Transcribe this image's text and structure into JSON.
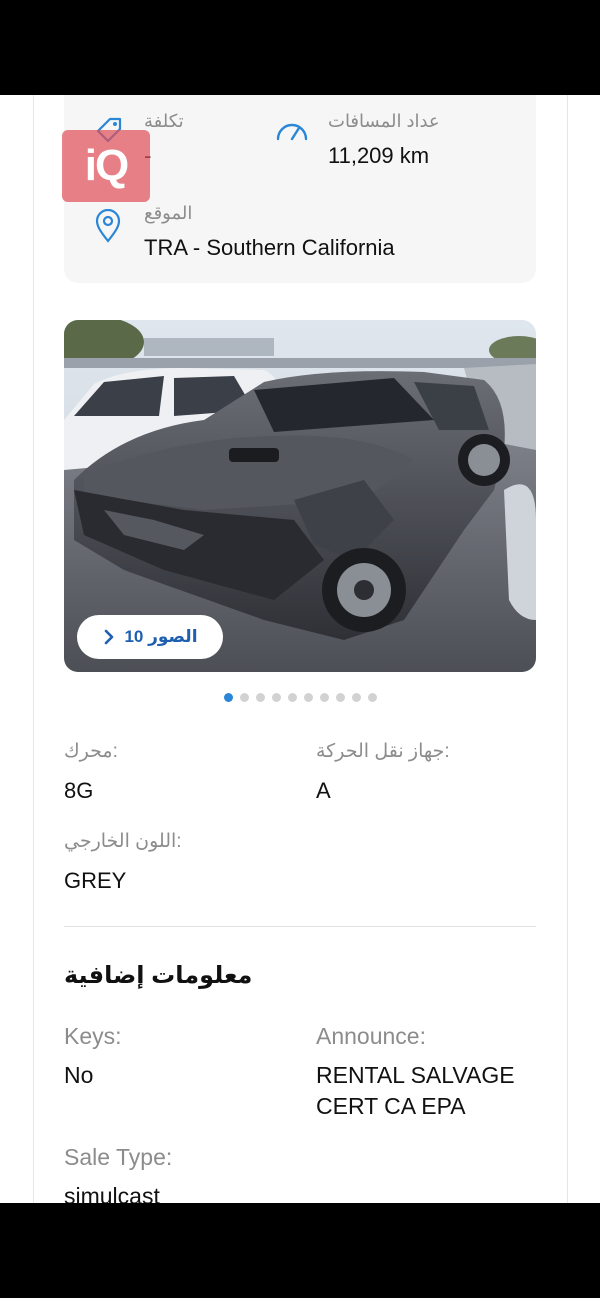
{
  "summary": {
    "cost_label": "تكلفة",
    "cost_value": "-",
    "odometer_label": "عداد المسافات",
    "odometer_value": "11,209 km",
    "location_label": "الموقع",
    "location_value": "TRA - Southern California"
  },
  "watermark": {
    "text": "iQ"
  },
  "gallery": {
    "photos_button_label": "الصور 10",
    "dot_count": 10,
    "active_dot": 0
  },
  "specs": {
    "engine_label": ":محرك",
    "engine_value": "8G",
    "transmission_label": ":جهاز نقل الحركة",
    "transmission_value": "A",
    "exterior_color_label": ":اللون الخارجي",
    "exterior_color_value": "GREY"
  },
  "additional": {
    "title": "معلومات إضافية",
    "keys_label": "Keys:",
    "keys_value": "No",
    "announce_label": "Announce:",
    "announce_value_line1": "RENTAL SALVAGE",
    "announce_value_line2": "CERT CA EPA",
    "sale_type_label": "Sale Type:",
    "sale_type_value": "simulcast"
  },
  "colors": {
    "accent": "#2a86d6",
    "link": "#1e5fb0"
  }
}
